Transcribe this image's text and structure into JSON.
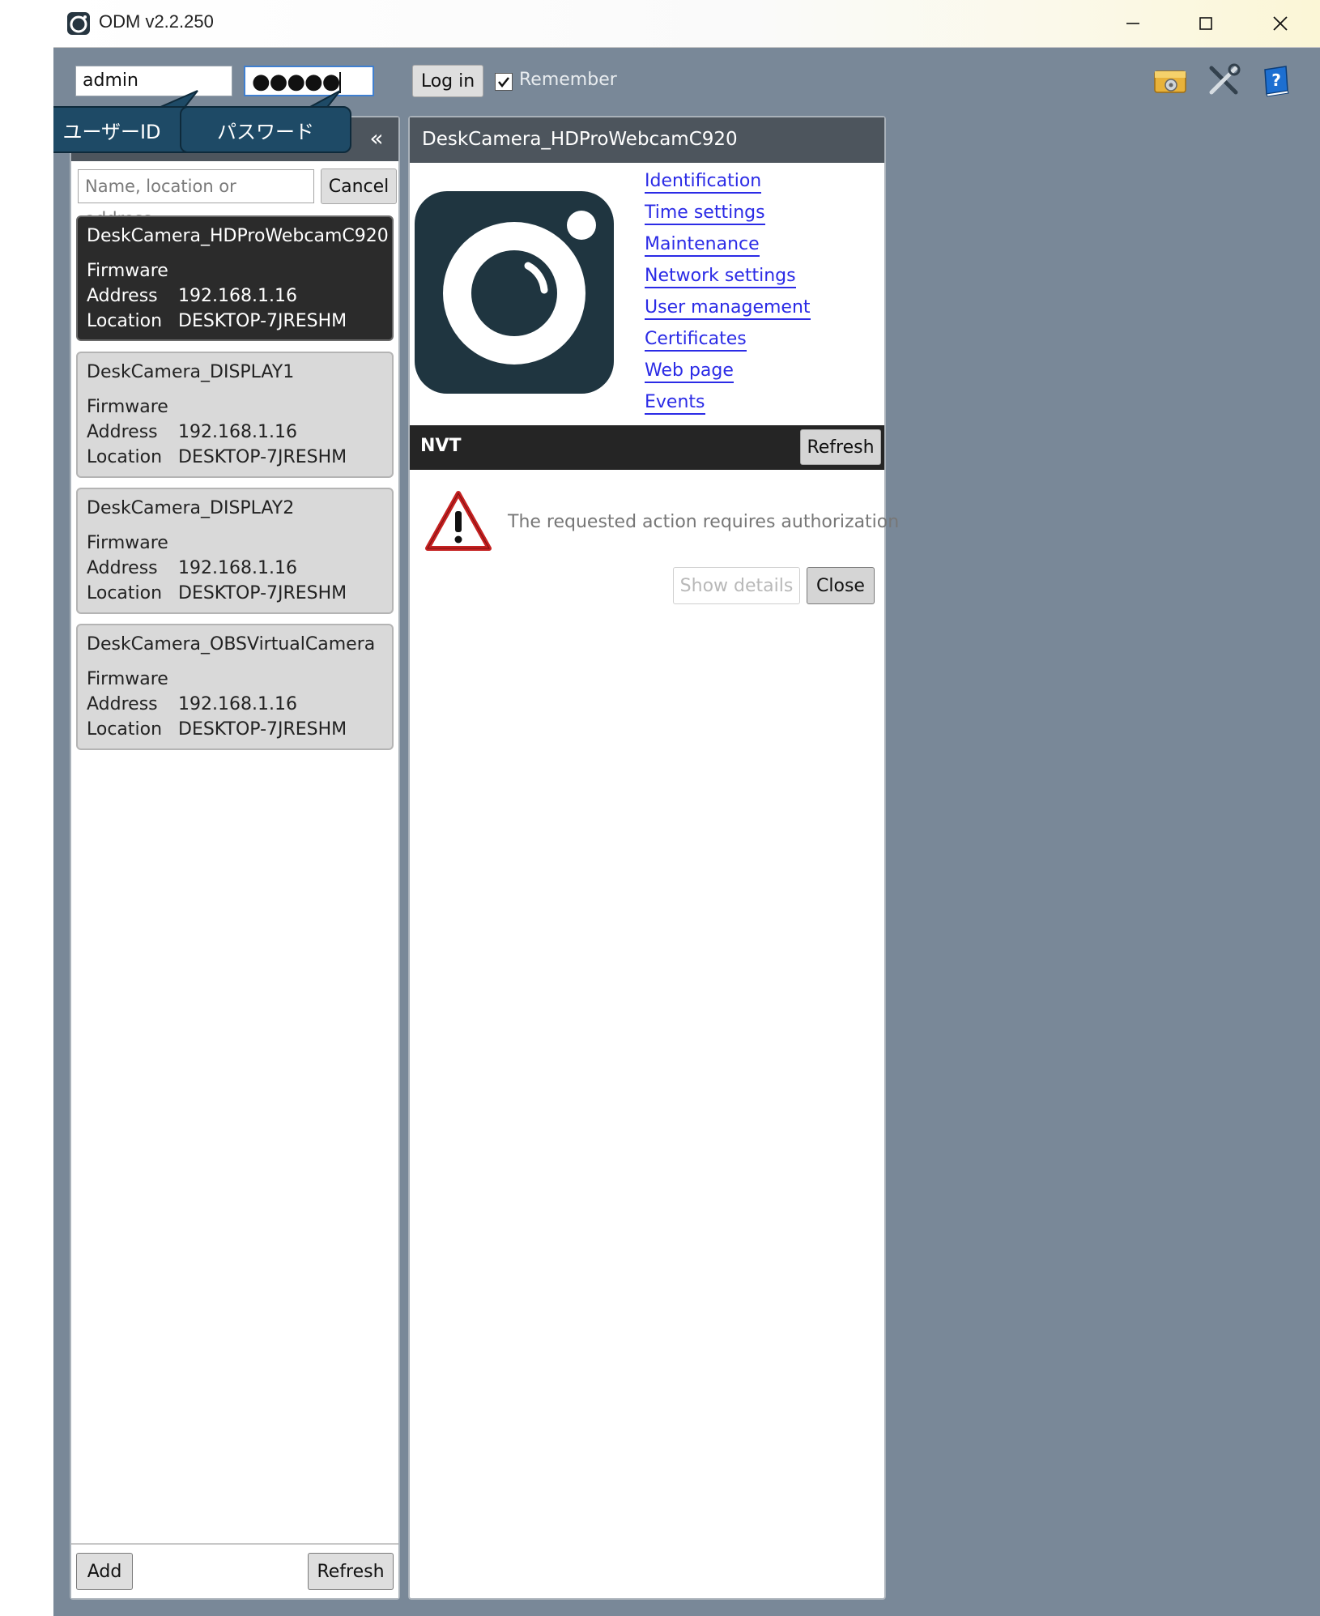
{
  "window": {
    "title": "ODM v2.2.250",
    "minimize": "—",
    "maximize": "☐",
    "close": "✕"
  },
  "login": {
    "username_value": "admin",
    "password_masked": "●●●●●",
    "login_label": "Log in",
    "remember_label": "Remember",
    "remember_checked": true
  },
  "toolbar_icons": [
    "settings-icon",
    "tools-icon",
    "help-book-icon"
  ],
  "callouts": {
    "user_id": "ユーザーID",
    "password": "パスワード"
  },
  "device_list": {
    "search_placeholder": "Name, location or address",
    "cancel_label": "Cancel",
    "firmware_label": "Firmware",
    "address_label": "Address",
    "location_label": "Location",
    "devices": [
      {
        "name": "DeskCamera_HDProWebcamC920",
        "address": "192.168.1.16",
        "location": "DESKTOP-7JRESHM"
      },
      {
        "name": "DeskCamera_DISPLAY1",
        "address": "192.168.1.16",
        "location": "DESKTOP-7JRESHM"
      },
      {
        "name": "DeskCamera_DISPLAY2",
        "address": "192.168.1.16",
        "location": "DESKTOP-7JRESHM"
      },
      {
        "name": "DeskCamera_OBSVirtualCamera",
        "address": "192.168.1.16",
        "location": "DESKTOP-7JRESHM"
      }
    ],
    "add_label": "Add",
    "refresh_label": "Refresh"
  },
  "detail": {
    "title": "DeskCamera_HDProWebcamC920",
    "menu": [
      "Identification",
      "Time settings",
      "Maintenance",
      "Network settings",
      "User management",
      "Certificates",
      "Web page",
      "Events"
    ],
    "nvt_label": "NVT",
    "nvt_refresh_label": "Refresh",
    "error_message": "The requested action requires authorization",
    "show_details_label": "Show details",
    "close_label": "Close"
  }
}
